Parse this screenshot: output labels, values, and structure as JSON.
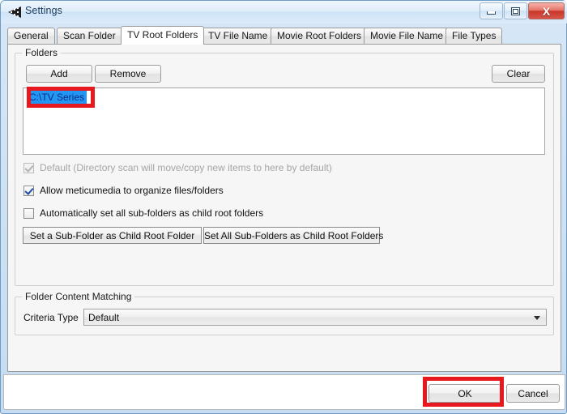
{
  "window": {
    "title": "Settings",
    "icon": "media-triangle-icon",
    "controls": {
      "minimize": "minimize-icon",
      "maximize": "maximize-icon",
      "close": "X"
    }
  },
  "tabs": [
    {
      "label": "General",
      "active": false
    },
    {
      "label": "Scan Folder",
      "active": false
    },
    {
      "label": "TV Root Folders",
      "active": true
    },
    {
      "label": "TV File Name",
      "active": false
    },
    {
      "label": "Movie Root Folders",
      "active": false
    },
    {
      "label": "Movie File Name",
      "active": false
    },
    {
      "label": "File Types",
      "active": false
    }
  ],
  "folders_group": {
    "legend": "Folders",
    "add_label": "Add",
    "remove_label": "Remove",
    "clear_label": "Clear",
    "items": [
      {
        "path": "C:\\TV Series",
        "selected": true
      }
    ]
  },
  "options": [
    {
      "label": "Default (Directory scan will move/copy new items to here by default)",
      "checked": true,
      "disabled": true
    },
    {
      "label": "Allow meticumedia to organize files/folders",
      "checked": true,
      "disabled": false
    },
    {
      "label": "Automatically set all sub-folders as child root folders",
      "checked": false,
      "disabled": false
    }
  ],
  "subfolder_buttons": {
    "set_one_label": "Set a Sub-Folder as Child Root Folder",
    "set_all_label": "Set All Sub-Folders as Child Root Folders"
  },
  "matching_group": {
    "legend": "Folder Content Matching",
    "criteria_label": "Criteria Type",
    "criteria_value": "Default"
  },
  "footer": {
    "ok_label": "OK",
    "cancel_label": "Cancel"
  },
  "annotations": {
    "highlight_color": "#e8191e",
    "targets": [
      "folder-list-selected-item",
      "ok-button"
    ]
  }
}
